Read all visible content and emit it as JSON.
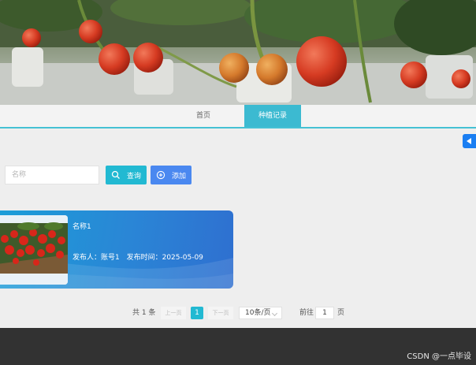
{
  "nav": {
    "items": [
      {
        "label": "首页",
        "active": false
      },
      {
        "label": "种植记录",
        "active": true
      }
    ]
  },
  "search": {
    "placeholder": "名称",
    "value": "",
    "query_label": "查询",
    "add_label": "添加"
  },
  "cards": [
    {
      "name": "名称1",
      "publisher": "发布人：账号1",
      "publish_time": "发布时间：2025-05-09"
    }
  ],
  "pagination": {
    "total": "共 1 条",
    "prev": "上一页",
    "current": "1",
    "next": "下一页",
    "page_size": "10条/页",
    "goto_label": "前往",
    "goto_value": "1",
    "page_unit": "页"
  },
  "footer": {
    "watermark": "CSDN @一点毕设"
  },
  "colors": {
    "accent": "#22b9d2",
    "add_button": "#4a88f0",
    "nav_active": "#3cbad1",
    "card_gradient_start": "#1a9fd8",
    "card_gradient_end": "#2f6fd0",
    "footer": "#323232"
  }
}
